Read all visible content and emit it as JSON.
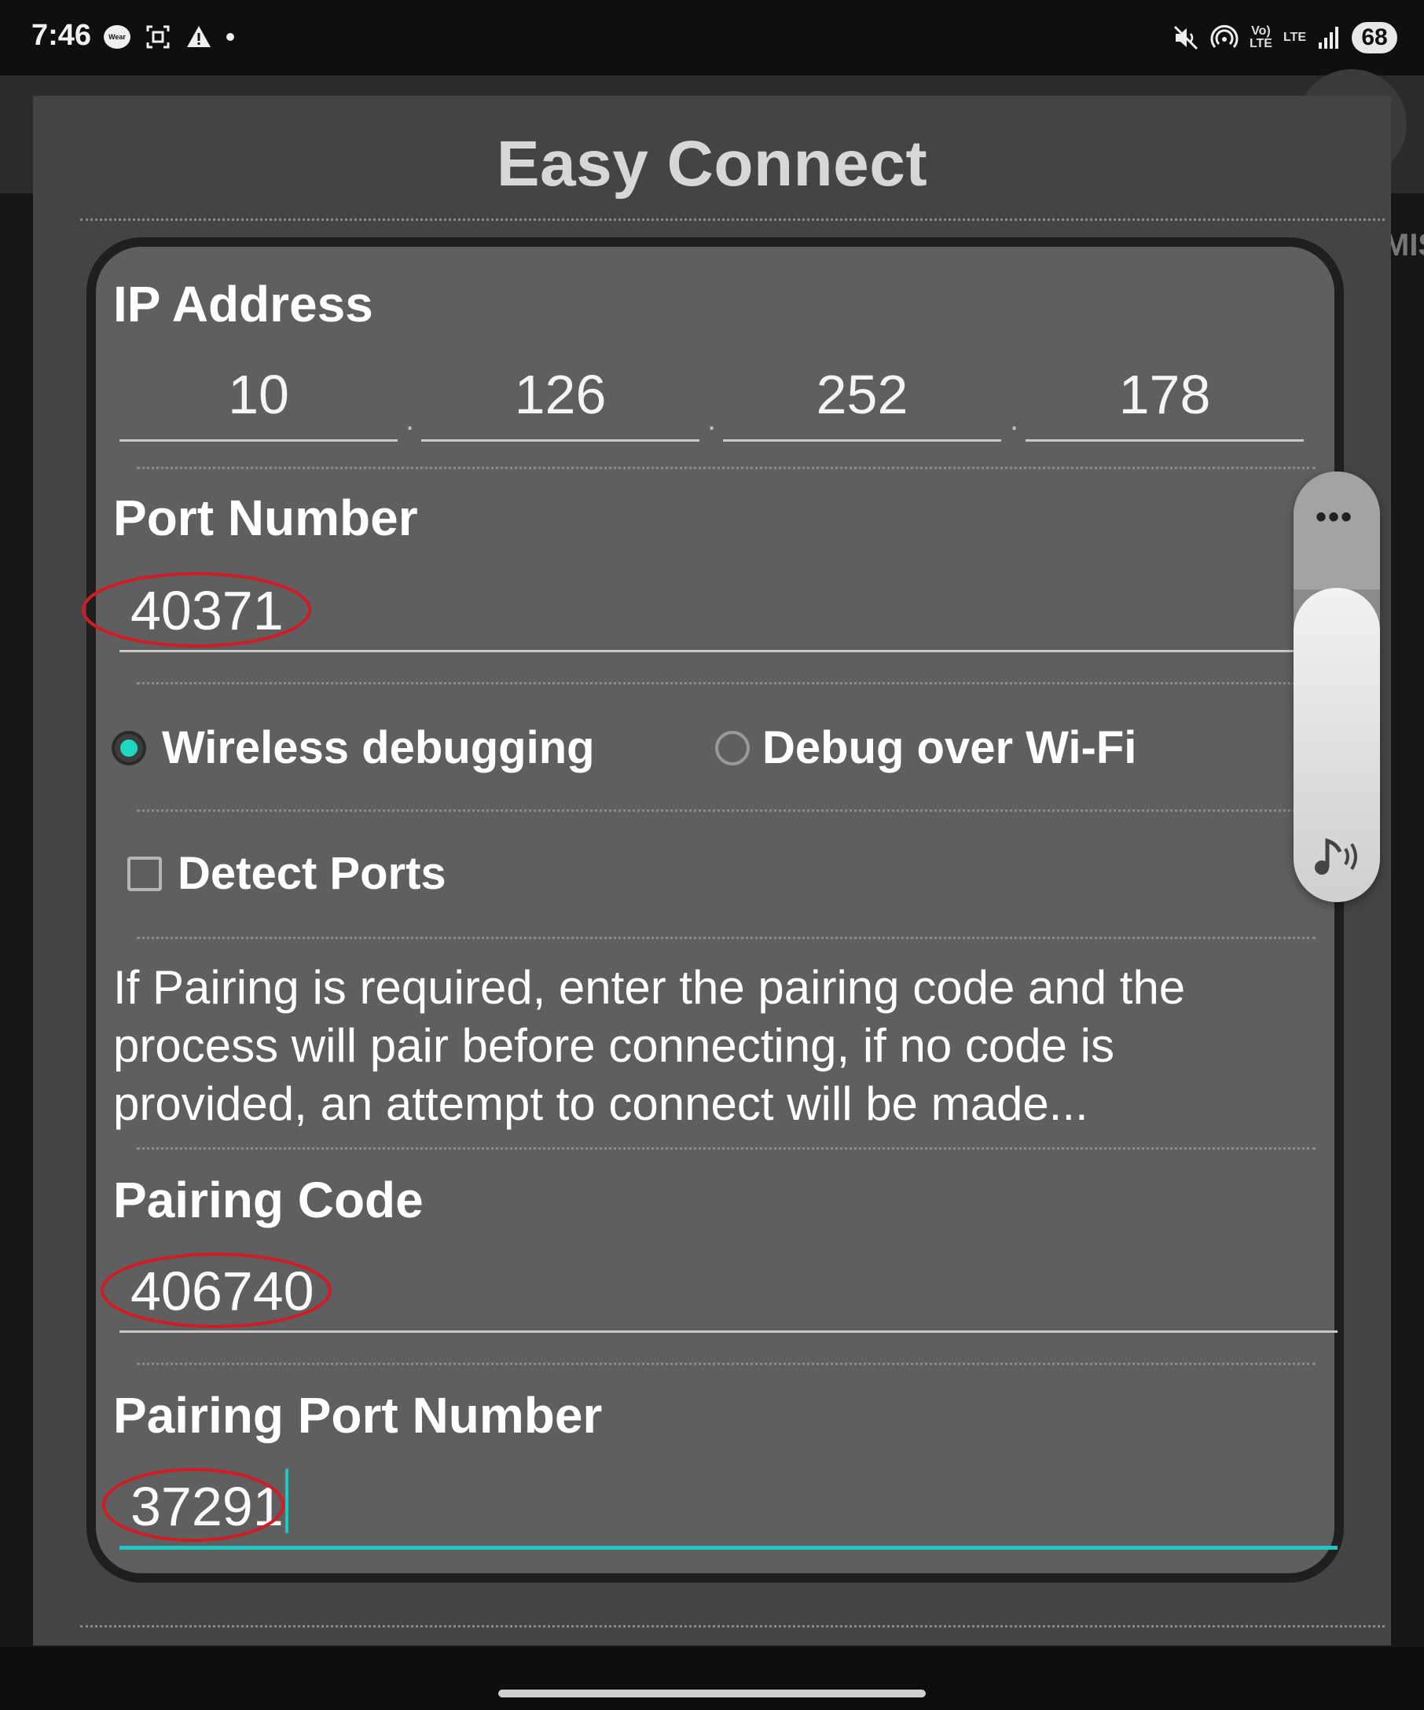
{
  "status_bar": {
    "time": "7:46",
    "left_icons": [
      "wear-os-icon",
      "screenshot-icon",
      "warning-icon",
      "dot-icon"
    ],
    "wear_badge": "Wear",
    "right_icons": [
      "mute-icon",
      "hotspot-icon",
      "volte-icon",
      "lte-icon",
      "signal-icon"
    ],
    "volte_text": "Vo)\nLTE",
    "lte_text": "LTE",
    "battery": "68"
  },
  "background": {
    "peek_text": "MIS"
  },
  "dialog": {
    "title": "Easy Connect",
    "ip": {
      "label": "IP Address",
      "octets": [
        "10",
        "126",
        "252",
        "178"
      ],
      "separator": "."
    },
    "port": {
      "label": "Port Number",
      "value": "40371"
    },
    "mode": {
      "options": [
        {
          "label": "Wireless debugging",
          "selected": true
        },
        {
          "label": "Debug over Wi-Fi",
          "selected": false
        }
      ]
    },
    "detect_ports": {
      "label": "Detect Ports",
      "checked": false
    },
    "info_text": "If Pairing is required, enter the pairing code and the process will pair before connecting, if no code is provided, an attempt to connect will be made...",
    "pairing_code": {
      "label": "Pairing Code",
      "value": "406740"
    },
    "pairing_port": {
      "label": "Pairing Port Number",
      "value": "37291",
      "focused": true
    }
  },
  "volume_panel": {
    "more_label": "•••",
    "level_percent": 75,
    "stream_icon": "music-volume-icon"
  },
  "colors": {
    "accent": "#1ec7c1",
    "annotation": "#d01c24",
    "dialog_bg": "#444444",
    "card_bg": "#5f5f5f"
  }
}
